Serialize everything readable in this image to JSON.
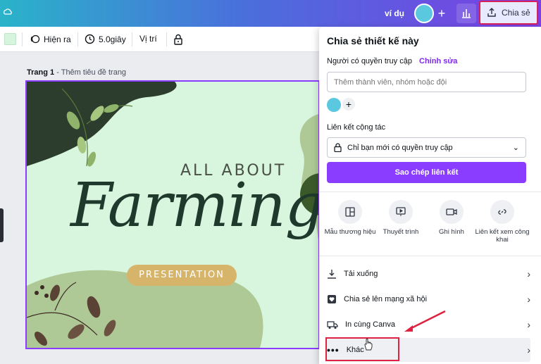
{
  "header": {
    "doc_title": "ví dụ",
    "share_label": "Chia sẻ"
  },
  "toolbar": {
    "appear_label": "Hiện ra",
    "duration_label": "5.0giây",
    "position_label": "Vị trí"
  },
  "page": {
    "label": "Trang 1",
    "subtitle": "Thêm tiêu đề trang"
  },
  "design": {
    "title_small": "ALL ABOUT",
    "title_big": "Farming",
    "pill": "PRESENTATION",
    "bg_color": "#d8f6dd"
  },
  "panel": {
    "title": "Chia sẻ thiết kế này",
    "access_label": "Người có quyền truy cập",
    "access_edit": "Chỉnh sửa",
    "invite_placeholder": "Thêm thành viên, nhóm hoặc đội",
    "collab_label": "Liên kết cộng tác",
    "collab_value": "Chỉ bạn mới có quyền truy cập",
    "copy_link": "Sao chép liên kết",
    "options": [
      {
        "label": "Mẫu thương hiệu",
        "icon": "template-icon"
      },
      {
        "label": "Thuyết trình",
        "icon": "present-icon"
      },
      {
        "label": "Ghi hình",
        "icon": "camera-icon"
      },
      {
        "label": "Liên kết xem công khai",
        "icon": "link-icon"
      }
    ],
    "rows": [
      {
        "label": "Tải xuống",
        "icon": "download-icon"
      },
      {
        "label": "Chia sẻ lên mạng xã hội",
        "icon": "heart-icon"
      },
      {
        "label": "In cùng Canva",
        "icon": "truck-icon"
      },
      {
        "label": "Khác",
        "icon": "more-icon"
      }
    ]
  },
  "colors": {
    "accent": "#8b3dff",
    "highlight": "#e0213f"
  }
}
